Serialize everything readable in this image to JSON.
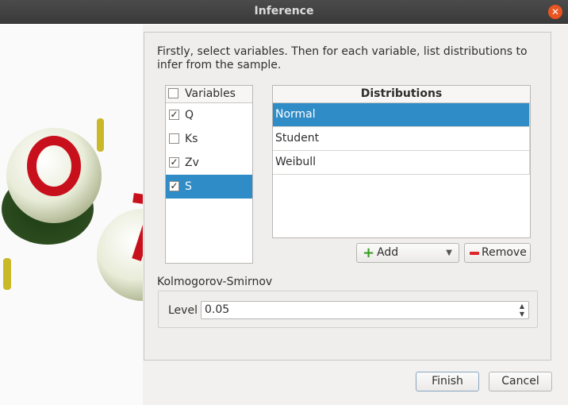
{
  "window": {
    "title": "Inference"
  },
  "intro": {
    "text": "Firstly, select variables. Then for each variable, list distributions to infer from the sample."
  },
  "variables": {
    "header": "Variables",
    "items": [
      {
        "label": "Q",
        "checked": true,
        "selected": false
      },
      {
        "label": "Ks",
        "checked": false,
        "selected": false
      },
      {
        "label": "Zv",
        "checked": true,
        "selected": false
      },
      {
        "label": "S",
        "checked": true,
        "selected": true
      }
    ]
  },
  "distributions": {
    "header": "Distributions",
    "items": [
      {
        "label": "Normal",
        "selected": true
      },
      {
        "label": "Student",
        "selected": false
      },
      {
        "label": "Weibull",
        "selected": false
      }
    ]
  },
  "buttons": {
    "add": "Add",
    "remove": "Remove",
    "finish": "Finish",
    "cancel": "Cancel"
  },
  "ks": {
    "group_label": "Kolmogorov-Smirnov",
    "level_label": "Level",
    "level_value": "0.05"
  },
  "icons": {
    "close": "close-icon",
    "add": "plus-icon",
    "remove": "minus-icon",
    "dropdown": "chevron-down-icon"
  },
  "colors": {
    "selection": "#308cc6",
    "titlebar": "#3d3d3d",
    "close": "#e95420"
  }
}
